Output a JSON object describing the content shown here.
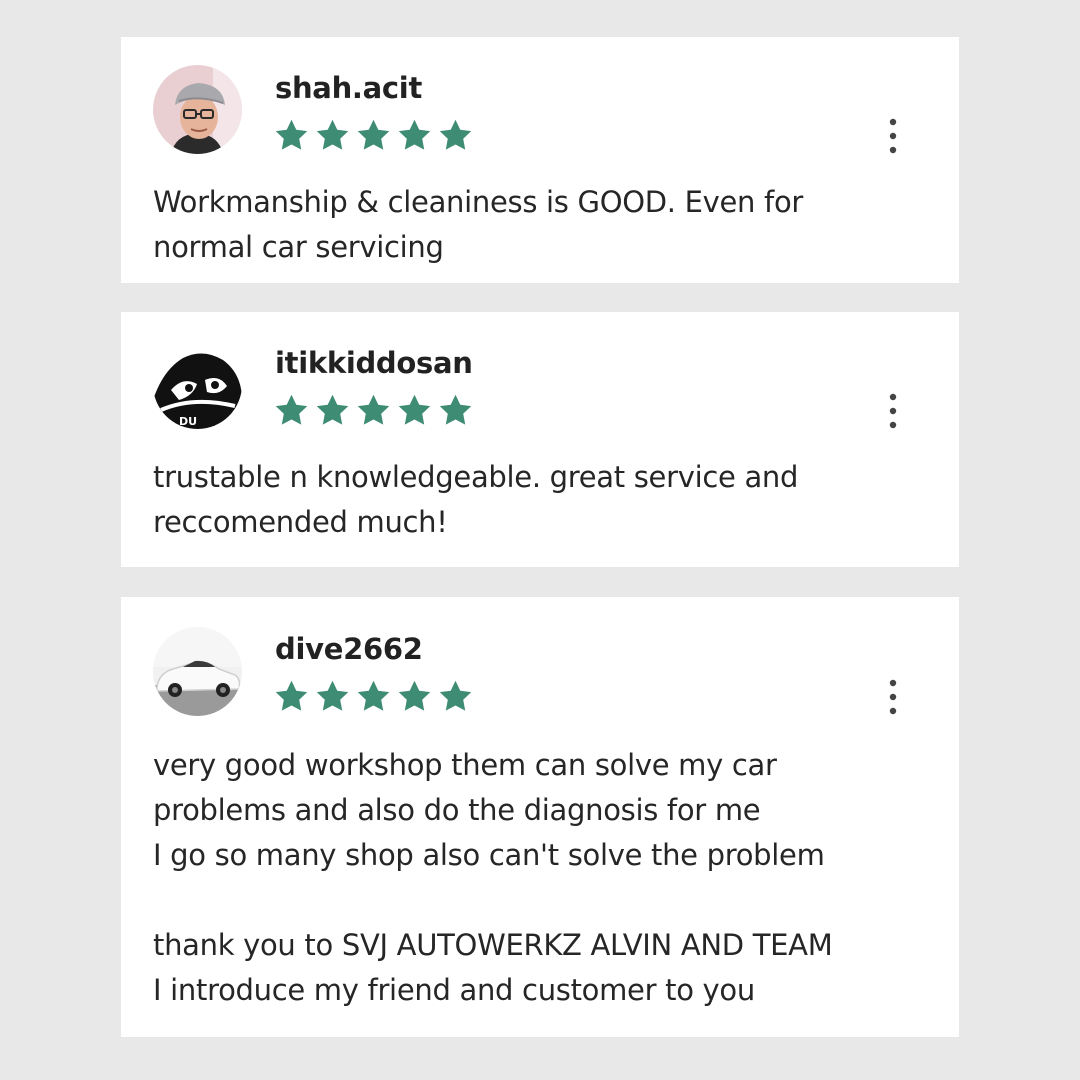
{
  "colors": {
    "background": "#e8e8e8",
    "card": "#ffffff",
    "star": "#3e8c74",
    "text": "#262626"
  },
  "reviews": [
    {
      "username": "shah.acit",
      "rating": 5,
      "avatar_icon": "user-photo-avatar",
      "text": "Workmanship & cleaniness is GOOD. Even for\nnormal car servicing"
    },
    {
      "username": "itikkiddosan",
      "rating": 5,
      "avatar_icon": "cartoon-duck-avatar",
      "text": "trustable n knowledgeable.  great service and\nreccomended much!"
    },
    {
      "username": "dive2662",
      "rating": 5,
      "avatar_icon": "white-car-avatar",
      "text": "very good workshop them can solve my car\nproblems and also do the diagnosis for me\nI go so many shop also can't solve the problem\n\nthank you to SVJ AUTOWERKZ  ALVIN AND TEAM\nI introduce my friend and customer to you"
    }
  ]
}
